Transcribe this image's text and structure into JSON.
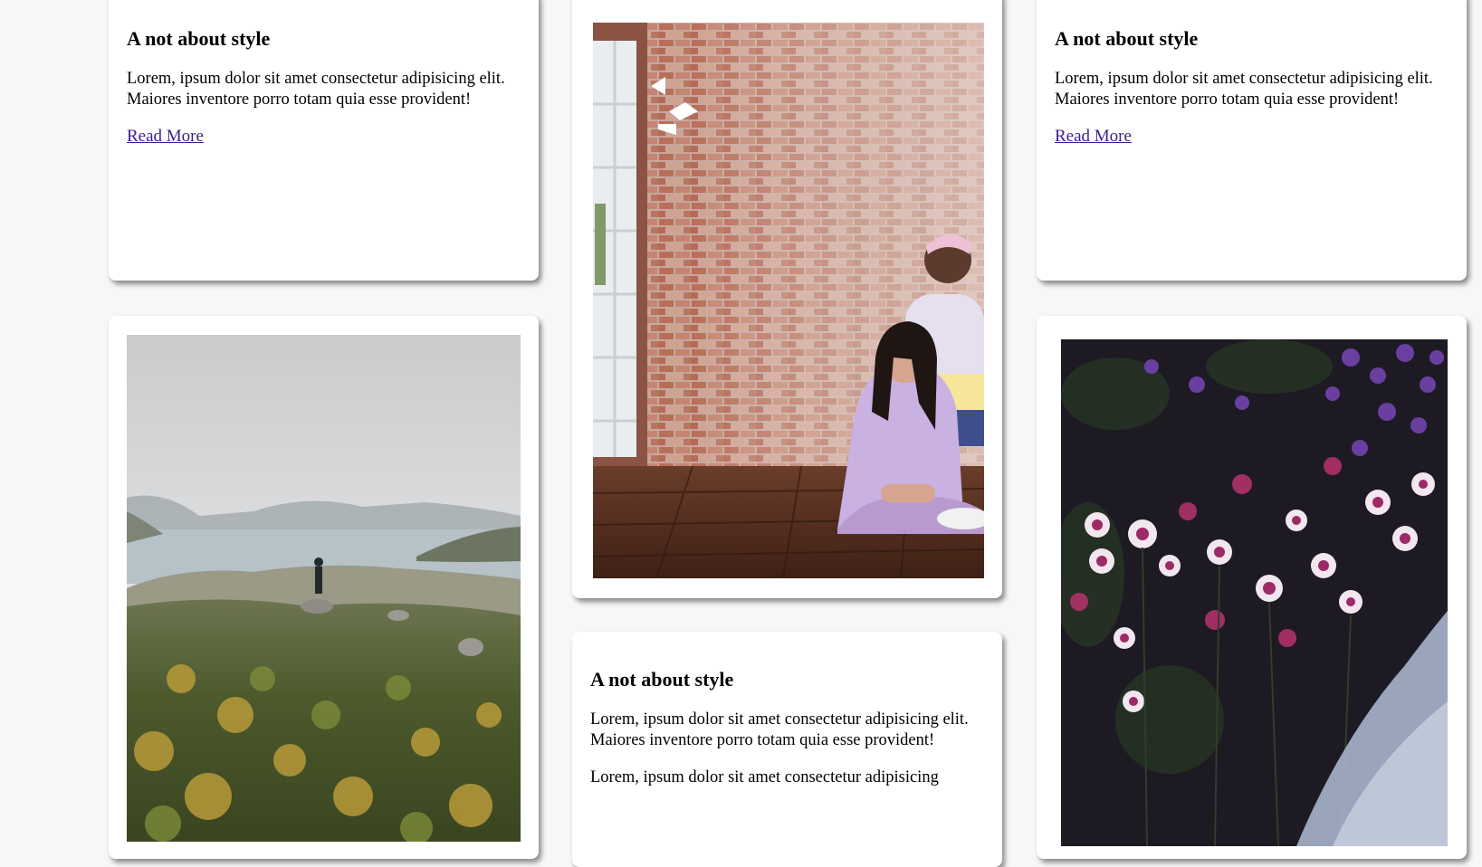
{
  "cards": [
    {
      "title": "A not about style",
      "body": "Lorem, ipsum dolor sit amet consectetur adipisicing elit. Maiores inventore porro totam quia esse provident!",
      "link": "Read More"
    },
    {
      "title": "A not about style",
      "body": "Lorem, ipsum dolor sit amet consectetur adipisicing elit. Maiores inventore porro totam quia esse provident!",
      "link": "Read More"
    },
    {
      "title": "A not about style",
      "body": "Lorem, ipsum dolor sit amet consectetur adipisicing elit. Maiores inventore porro totam quia esse provident!",
      "body2": "Lorem, ipsum dolor sit amet consectetur adipisicing"
    }
  ],
  "images": {
    "loft": "loft-photo",
    "mountain": "mountain-photo",
    "flowers": "flowers-photo"
  },
  "colors": {
    "background": "#f7f7f7",
    "card": "#ffffff",
    "link": "#3a1f8a"
  }
}
